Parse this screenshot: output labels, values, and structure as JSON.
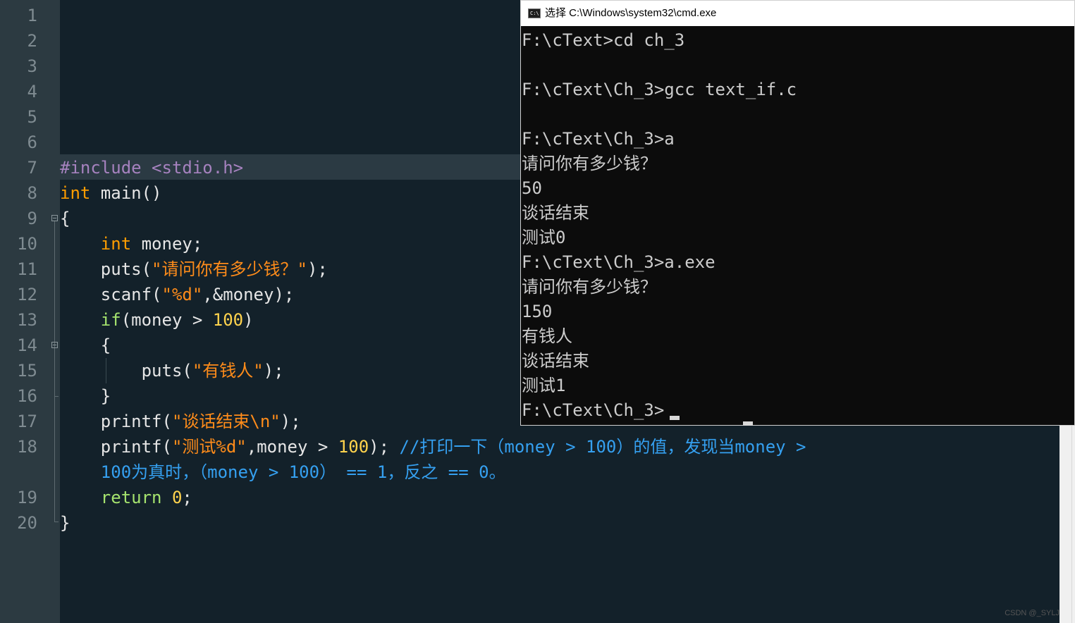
{
  "editor": {
    "line_numbers": [
      "1",
      "2",
      "3",
      "4",
      "5",
      "6",
      "7",
      "8",
      "9",
      "10",
      "11",
      "12",
      "13",
      "14",
      "15",
      "16",
      "17",
      "18",
      "",
      "19",
      "20"
    ],
    "code": {
      "l7": {
        "directive": "#include",
        "header": " <stdio.h>"
      },
      "l8": {
        "type": "int",
        "rest": " main()"
      },
      "l9": {
        "brace": "{"
      },
      "l10": {
        "indent": "    ",
        "type": "int",
        "rest": " money;"
      },
      "l11": {
        "indent": "    ",
        "fn": "puts(",
        "str": "\"请问你有多少钱？\"",
        "end": ");"
      },
      "l12": {
        "indent": "    ",
        "fn": "scanf(",
        "str": "\"%d\"",
        "end": ",&money);"
      },
      "l13": {
        "indent": "    ",
        "kw": "if",
        "mid": "(money > ",
        "num": "100",
        "end": ")"
      },
      "l14": {
        "text": "    {"
      },
      "l15": {
        "indent": "        ",
        "fn": "puts(",
        "str": "\"有钱人\"",
        "end": ");"
      },
      "l16": {
        "text": "    }"
      },
      "l17": {
        "indent": "    ",
        "fn": "printf(",
        "str": "\"谈话结束\\n\"",
        "end": ");"
      },
      "l18": {
        "indent": "    ",
        "fn": "printf(",
        "str": "\"测试%d\"",
        "mid": ",money > ",
        "num": "100",
        "end": "); ",
        "comment": "//打印一下（money > 100）的值，发现当money >"
      },
      "l18b": {
        "indent": "    ",
        "comment": "100为真时，（money > 100） == 1，反之 == 0。"
      },
      "l19": {
        "indent": "    ",
        "kw": "return",
        "sp": " ",
        "num": "0",
        "end": ";"
      },
      "l20": {
        "brace": "}"
      }
    }
  },
  "cmd": {
    "title": "选择 C:\\Windows\\system32\\cmd.exe",
    "icon_text": "C:\\",
    "lines": [
      "F:\\cText>cd ch_3",
      "",
      "F:\\cText\\Ch_3>gcc text_if.c",
      "",
      "F:\\cText\\Ch_3>a",
      "请问你有多少钱？",
      "50",
      "谈话结束",
      "测试0",
      "F:\\cText\\Ch_3>a.exe",
      "请问你有多少钱？",
      "150",
      "有钱人",
      "谈话结束",
      "测试1",
      "F:\\cText\\Ch_3>"
    ]
  },
  "watermark": "CSDN @_SYLJ",
  "colors": {
    "editor_bg": "#13212a",
    "gutter_bg": "#2c3a41",
    "keyword_type": "#ff9d00",
    "keyword_control": "#a5e36e",
    "string": "#ff8c1a",
    "number": "#ffd34d",
    "comment": "#35a0f0",
    "preprocessor": "#a682bf",
    "terminal_bg": "#0c0c0c",
    "terminal_fg": "#cccccc"
  }
}
